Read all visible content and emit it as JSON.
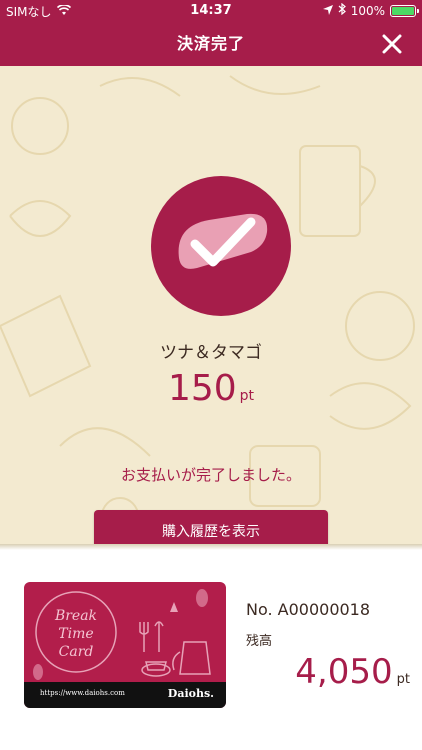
{
  "status_bar": {
    "carrier": "SIMなし",
    "time": "14:37",
    "battery": "100%"
  },
  "header": {
    "title": "決済完了"
  },
  "payment": {
    "item_name": "ツナ＆タマゴ",
    "points": "150",
    "points_unit": "pt",
    "message": "お支払いが完了しました。",
    "history_button": "購入履歴を表示"
  },
  "card": {
    "title_lines": [
      "Break",
      "Time",
      "Card"
    ],
    "url": "https://www.daiohs.com",
    "brand": "Daiohs.",
    "number": "No. A00000018",
    "balance_label": "残高",
    "balance": "4,050",
    "balance_unit": "pt"
  },
  "colors": {
    "accent": "#a61d4a",
    "paper": "#f3ead0"
  },
  "icons": [
    "wifi-icon",
    "location-icon",
    "bluetooth-icon",
    "battery-icon",
    "close-icon",
    "bread-check-icon"
  ]
}
